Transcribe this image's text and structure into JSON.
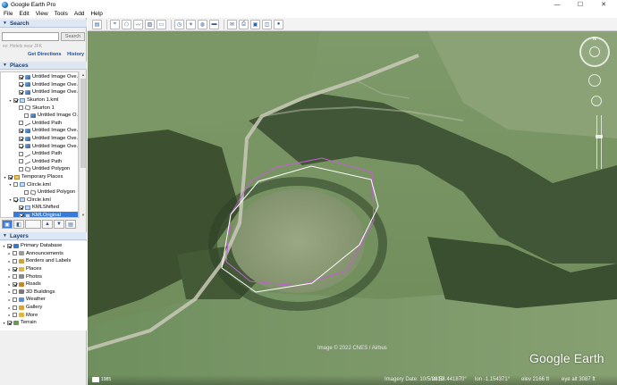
{
  "window": {
    "title": "Google Earth Pro"
  },
  "menu": {
    "file": "File",
    "edit": "Edit",
    "view": "View",
    "tools": "Tools",
    "add": "Add",
    "help": "Help"
  },
  "search": {
    "header": "Search",
    "button": "Search",
    "hint": "ex: Hotels near JFK",
    "get_directions": "Get Directions",
    "history": "History"
  },
  "places": {
    "header": "Places",
    "items": [
      {
        "label": "Untitled Image Ove...",
        "icon": "image-overlay-icon",
        "checked": true,
        "indent": 2
      },
      {
        "label": "Untitled Image Ove...",
        "icon": "image-overlay-icon",
        "checked": true,
        "indent": 2
      },
      {
        "label": "Untitled Image Ove...",
        "icon": "image-overlay-icon",
        "checked": true,
        "indent": 2
      },
      {
        "label": "Skurton 1.kml",
        "icon": "kml-icon",
        "checked": true,
        "indent": 1,
        "expanded": true
      },
      {
        "label": "Skurton 1",
        "icon": "polygon-icon",
        "checked": false,
        "indent": 2
      },
      {
        "label": "Untitled Image O...",
        "icon": "image-overlay-icon",
        "checked": false,
        "indent": 3
      },
      {
        "label": "Untitled Path",
        "icon": "path-icon",
        "checked": false,
        "indent": 2
      },
      {
        "label": "Untitled Image Ove...",
        "icon": "image-overlay-icon",
        "checked": true,
        "indent": 2
      },
      {
        "label": "Untitled Image Ove...",
        "icon": "image-overlay-icon",
        "checked": true,
        "indent": 2
      },
      {
        "label": "Untitled Image Ove...",
        "icon": "image-overlay-icon",
        "checked": true,
        "indent": 2
      },
      {
        "label": "Untitled Path",
        "icon": "path-icon",
        "checked": false,
        "indent": 2
      },
      {
        "label": "Untitled Path",
        "icon": "path-icon",
        "checked": false,
        "indent": 2
      },
      {
        "label": "Untitled Polygon",
        "icon": "polygon-icon",
        "checked": false,
        "indent": 2
      },
      {
        "label": "Temporary Places",
        "icon": "folder-icon",
        "checked": true,
        "indent": 0,
        "expanded": true
      },
      {
        "label": "Clircle.kml",
        "icon": "kml-icon",
        "checked": false,
        "indent": 1,
        "expanded": true
      },
      {
        "label": "Untitled Polygon",
        "icon": "polygon-icon",
        "checked": false,
        "indent": 3
      },
      {
        "label": "Clircle.kml",
        "icon": "kml-icon",
        "checked": true,
        "indent": 1,
        "expanded": true
      },
      {
        "label": "KMLShifted",
        "icon": "kml-icon",
        "checked": true,
        "indent": 2
      },
      {
        "label": "KMLOriginal",
        "icon": "kml-icon",
        "checked": true,
        "indent": 2,
        "selected": true
      }
    ]
  },
  "layers": {
    "header": "Layers",
    "items": [
      {
        "label": "Primary Database",
        "icon": "globe-icon",
        "checked": true,
        "indent": 0,
        "color": "#3a77c9"
      },
      {
        "label": "Announcements",
        "icon": "announcement-icon",
        "checked": false,
        "indent": 1,
        "color": "#9b9b9b"
      },
      {
        "label": "Borders and Labels",
        "icon": "borders-icon",
        "checked": false,
        "indent": 1,
        "color": "#c9a24a"
      },
      {
        "label": "Places",
        "icon": "places-icon",
        "checked": true,
        "indent": 1,
        "color": "#e0b542"
      },
      {
        "label": "Photos",
        "icon": "photos-icon",
        "checked": false,
        "indent": 1,
        "color": "#8a8a8a"
      },
      {
        "label": "Roads",
        "icon": "roads-icon",
        "checked": true,
        "indent": 1,
        "color": "#c28a2e"
      },
      {
        "label": "3D Buildings",
        "icon": "buildings-icon",
        "checked": false,
        "indent": 1,
        "color": "#7a7a7a"
      },
      {
        "label": "Weather",
        "icon": "weather-icon",
        "checked": false,
        "indent": 1,
        "color": "#5a8fd1"
      },
      {
        "label": "Gallery",
        "icon": "gallery-icon",
        "checked": false,
        "indent": 1,
        "color": "#d8a23a"
      },
      {
        "label": "More",
        "icon": "more-icon",
        "checked": false,
        "indent": 1,
        "color": "#e0b542"
      },
      {
        "label": "Terrain",
        "icon": "terrain-icon",
        "checked": true,
        "indent": 0,
        "color": "#6a9a5a"
      }
    ]
  },
  "map": {
    "copyright": "Image © 2022 CNES / Airbus",
    "logo": "Google Earth",
    "year_badge": "1985",
    "status": {
      "imagery_date": "Imagery Date: 10/5/2019",
      "lat": "lat   53.441870°",
      "lon": "lon  -1.154371°",
      "elev": "elev   2166 ft",
      "eye_alt": "eye alt   3087 ft"
    },
    "compass_label": "N"
  },
  "colors": {
    "panel_header_bg": "#dde7f3",
    "panel_header_text": "#1a3f78",
    "selection": "#3a7bd5",
    "polygon_white": "#ffffff",
    "polygon_magenta": "#c15fd6"
  }
}
